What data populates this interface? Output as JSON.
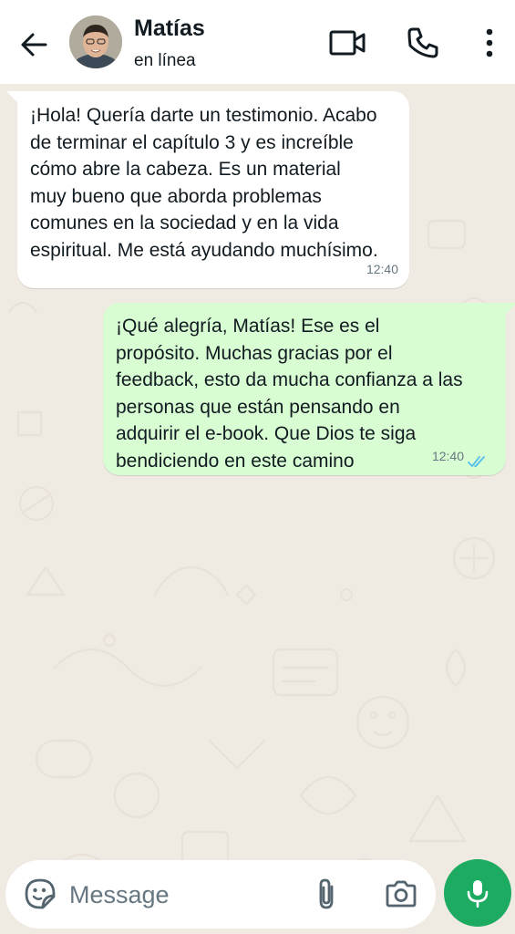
{
  "header": {
    "contact_name": "Matías",
    "status": "en línea",
    "back_icon": "arrow-left-icon",
    "video_icon": "video-call-icon",
    "call_icon": "phone-icon",
    "more_icon": "more-vertical-icon"
  },
  "messages": [
    {
      "direction": "incoming",
      "text": "¡Hola! Quería darte un testimonio. Acabo\nde terminar el capítulo 3 y es increíble\ncómo abre la cabeza. Es un material\nmuy bueno que aborda problemas\ncomunes en la sociedad y en la vida\nespiritual. Me está ayudando muchísimo.",
      "time": "12:40"
    },
    {
      "direction": "outgoing",
      "text": "¡Qué alegría, Matías! Ese es el\npropósito. Muchas gracias por el\nfeedback, esto da mucha confianza a las\npersonas que están pensando en\nadquirir el e-book. Que Dios te siga\nbendiciendo en este camino",
      "time": "12:40",
      "status": "read"
    }
  ],
  "composer": {
    "placeholder": "Message",
    "value": ""
  },
  "colors": {
    "header_bg": "#ffffff",
    "chat_bg": "#efeae2",
    "incoming_bubble": "#ffffff",
    "outgoing_bubble": "#d9fdd3",
    "mic_button": "#1daa61",
    "read_ticks": "#53bdeb"
  }
}
